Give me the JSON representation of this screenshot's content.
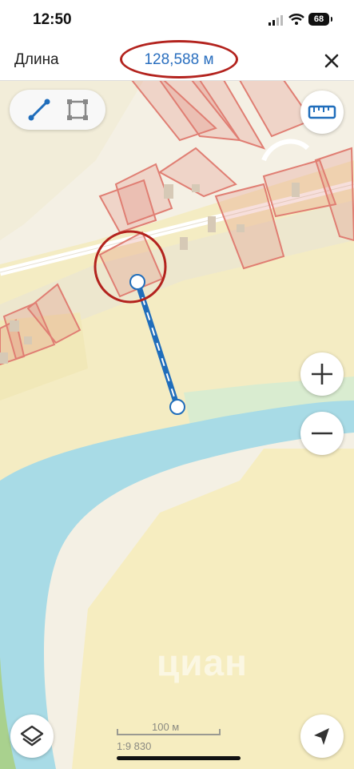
{
  "status_bar": {
    "time": "12:50",
    "battery": "68"
  },
  "header": {
    "label": "Длина",
    "value": "128,588 м"
  },
  "scale": {
    "distance": "100 м",
    "ratio": "1:9 830"
  },
  "watermark": "циан",
  "icons": {
    "close": "close-icon",
    "mode_line": "line-tool-icon",
    "mode_polygon": "polygon-tool-icon",
    "ruler": "ruler-icon",
    "zoom_in": "plus-icon",
    "zoom_out": "minus-icon",
    "layers": "layers-icon",
    "locate": "location-arrow-icon"
  },
  "colors": {
    "value_text": "#2a6fbf",
    "highlight": "#b3231e",
    "measure_line": "#1f6dbb",
    "parcel": "#e07e73",
    "river": "#a8dbe6"
  }
}
